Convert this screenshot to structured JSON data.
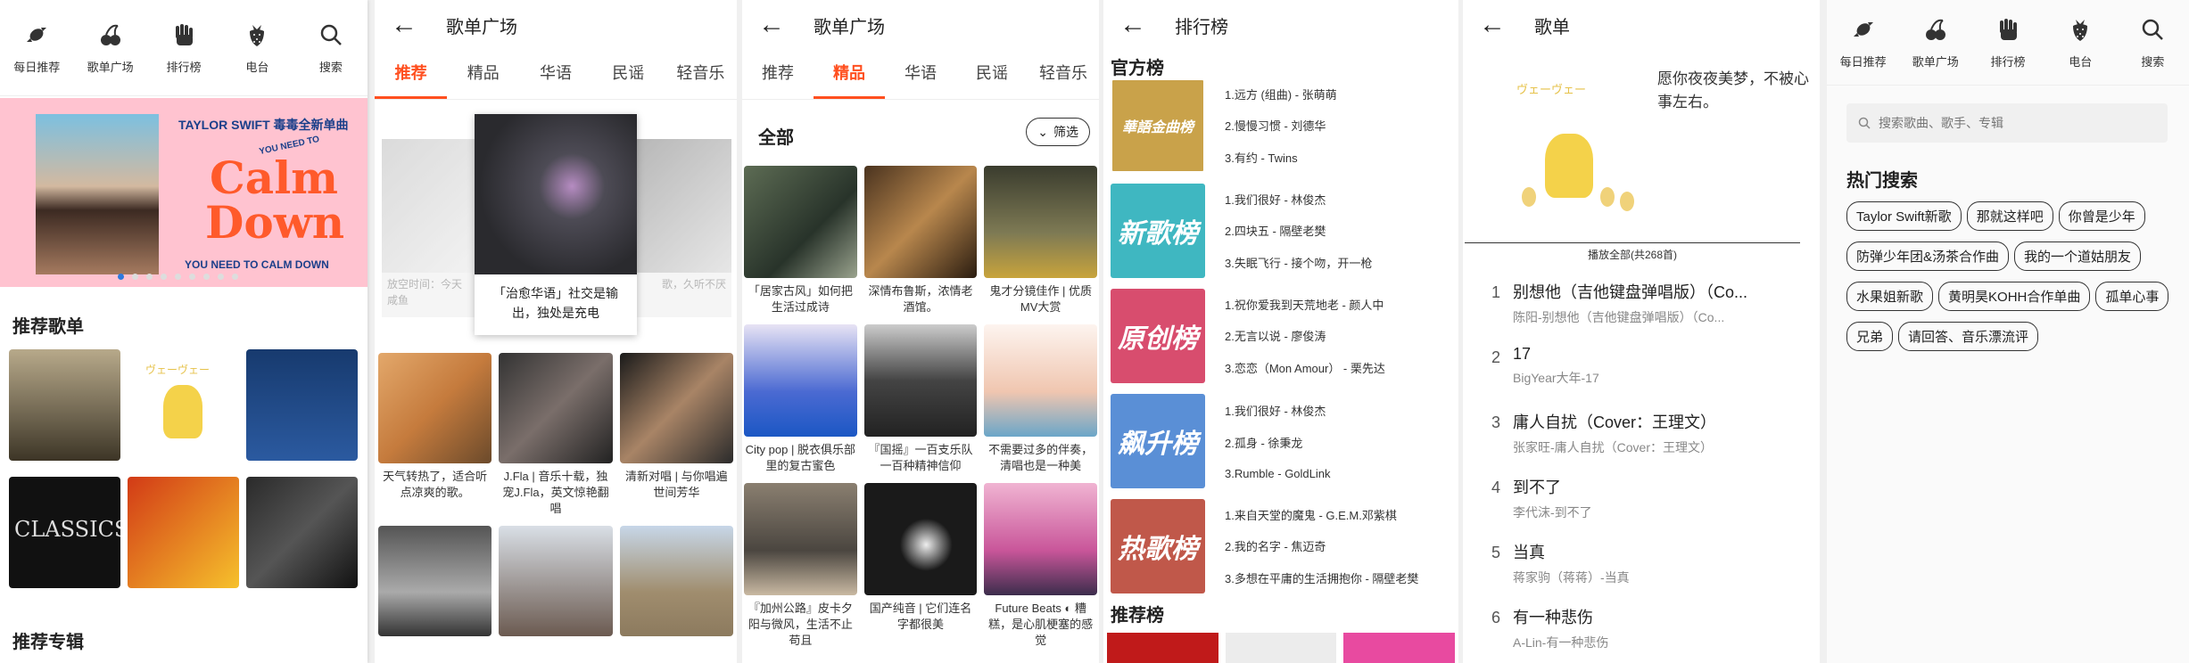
{
  "nav": [
    {
      "label": "每日推荐",
      "icon": "candy-icon"
    },
    {
      "label": "歌单广场",
      "icon": "cherry-icon"
    },
    {
      "label": "排行榜",
      "icon": "hand-icon"
    },
    {
      "label": "电台",
      "icon": "strawberry-icon"
    },
    {
      "label": "搜索",
      "icon": "search-icon"
    }
  ],
  "home": {
    "banner_title": "TAYLOR SWIFT  毒毒全新单曲",
    "banner_small": "YOU NEED TO",
    "banner_big1": "Calm",
    "banner_big2": "Down",
    "banner_bottom": "YOU NEED TO CALM DOWN",
    "dots": 9,
    "rec_playlists": "推荐歌单",
    "rec_albums": "推荐专辑",
    "tile_texts": [
      "",
      "ヴェーヴェー",
      "",
      "CLASSICS",
      "",
      ""
    ]
  },
  "square": {
    "title": "歌单广场",
    "tabs": [
      "推荐",
      "精品",
      "华语",
      "民谣",
      "轻音乐"
    ],
    "active_tab": 0,
    "carousel_center": "「治愈华语」社交是输出，独处是充电",
    "carousel_left": "放空时间：今天 咸鱼",
    "carousel_right": "歌，久听不厌",
    "items": [
      "天气转热了，适合听点凉爽的歌。",
      "J.Fla | 音乐十载，独宠J.Fla，英文惊艳翻唱",
      "清新对唱 | 与你唱遍世间芳华",
      "",
      "",
      ""
    ]
  },
  "quality": {
    "title": "歌单广场",
    "tabs": [
      "推荐",
      "精品",
      "华语",
      "民谣",
      "轻音乐"
    ],
    "active_tab": 1,
    "all_label": "全部",
    "filter_label": "筛选",
    "items": [
      "「居家古风」如何把生活过成诗",
      "深情布鲁斯，浓情老酒馆。",
      "鬼才分镜佳作 | 优质MV大赏",
      "City pop | 脱衣俱乐部里的复古蜜色",
      "『国摇』一百支乐队一百种精神信仰",
      "不需要过多的伴奏，清唱也是一种美",
      "『加州公路』皮卡夕阳与微风，生活不止苟且",
      "国产纯音 | 它们连名字都很美",
      "Future Beats ◐ 糟糕，是心肌梗塞的感觉"
    ]
  },
  "ranking": {
    "title": "排行榜",
    "official": "官方榜",
    "recommend": "推荐榜",
    "boards": [
      {
        "cover": "華語金曲榜",
        "color": "#c9a24a",
        "songs": [
          "1.远方 (组曲) - 张萌萌",
          "2.慢慢习惯 - 刘德华",
          "3.有约 - Twins"
        ]
      },
      {
        "cover": "新歌榜",
        "color": "#3fb7c1",
        "songs": [
          "1.我们很好 - 林俊杰",
          "2.四块五 - 隔壁老樊",
          "3.失眠飞行 - 接个吻，开一枪"
        ]
      },
      {
        "cover": "原创榜",
        "color": "#d84d6e",
        "songs": [
          "1.祝你爱我到天荒地老 - 颜人中",
          "2.无言以说 - 廖俊涛",
          "3.恋恋（Mon Amour） - 栗先达"
        ]
      },
      {
        "cover": "飙升榜",
        "color": "#5a8fd6",
        "songs": [
          "1.我们很好 - 林俊杰",
          "2.孤身 - 徐秉龙",
          "3.Rumble - GoldLink"
        ]
      },
      {
        "cover": "热歌榜",
        "color": "#c0584a",
        "songs": [
          "1.来自天堂的魔鬼 - G.E.M.邓紫棋",
          "2.我的名字 - 焦迈奇",
          "3.多想在平庸的生活拥抱你 - 隔壁老樊"
        ]
      }
    ]
  },
  "playlist": {
    "title": "歌单",
    "cover_text": "ヴェーヴェー",
    "desc": "愿你夜夜美梦，不被心事左右。",
    "play_all": "播放全部(共268首)",
    "songs": [
      {
        "no": "1",
        "title": "别想他（吉他键盘弹唱版）（Co...",
        "artist": "陈阳-别想他（吉他键盘弹唱版）（Co..."
      },
      {
        "no": "2",
        "title": "17",
        "artist": "BigYear大年-17"
      },
      {
        "no": "3",
        "title": "庸人自扰（Cover：王理文）",
        "artist": "张家旺-庸人自扰（Cover：王理文）"
      },
      {
        "no": "4",
        "title": "到不了",
        "artist": "李代沫-到不了"
      },
      {
        "no": "5",
        "title": "当真",
        "artist": "蒋家驹（蒋蒋）-当真"
      },
      {
        "no": "6",
        "title": "有一种悲伤",
        "artist": "A-Lin-有一种悲伤"
      }
    ]
  },
  "search": {
    "placeholder": "搜索歌曲、歌手、专辑",
    "hot_title": "热门搜索",
    "hot": [
      "Taylor Swift新歌",
      "那就这样吧",
      "你曾是少年",
      "防弹少年团&汤茶合作曲",
      "我的一个道姑朋友",
      "水果姐新歌",
      "黄明昊KOHH合作单曲",
      "孤单心事",
      "兄弟",
      "请回答、音乐漂流评"
    ]
  }
}
